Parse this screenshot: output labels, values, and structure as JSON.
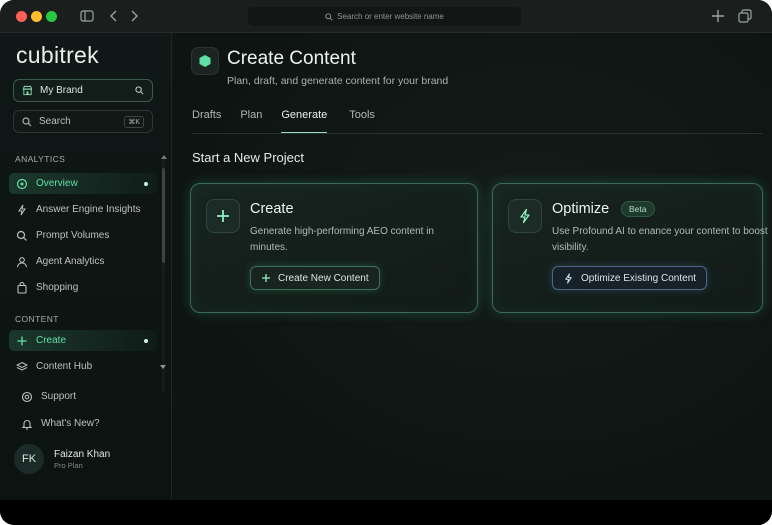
{
  "browser": {
    "url_placeholder": "Search or enter website name"
  },
  "sidebar": {
    "logo": "cubitrek",
    "brand_selector": "My Brand",
    "search_label": "Search",
    "search_shortcut": "⌘K",
    "analytics_label": "ANALYTICS",
    "analytics_items": [
      {
        "label": "Overview",
        "icon": "overview-icon",
        "active": true
      },
      {
        "label": "Answer Engine Insights",
        "icon": "spark-icon"
      },
      {
        "label": "Prompt Volumes",
        "icon": "search-icon"
      },
      {
        "label": "Agent Analytics",
        "icon": "agent-icon"
      },
      {
        "label": "Shopping",
        "icon": "shopping-bag-icon"
      }
    ],
    "content_label": "CONTENT",
    "content_items": [
      {
        "label": "Create",
        "icon": "plus-icon",
        "active": true
      },
      {
        "label": "Content Hub",
        "icon": "layers-icon"
      }
    ],
    "support": "Support",
    "whats_new": "What's New?",
    "user": {
      "initials": "FK",
      "name": "Faizan Khan",
      "plan": "Pro Plan"
    }
  },
  "main": {
    "title": "Create Content",
    "subtitle": "Plan, draft, and generate content for your brand",
    "tabs": [
      {
        "label": "Drafts"
      },
      {
        "label": "Plan"
      },
      {
        "label": "Generate",
        "active": true
      },
      {
        "label": "Tools"
      }
    ],
    "section_title": "Start a New Project",
    "cards": [
      {
        "title": "Create",
        "description": "Generate high-performing AEO content in minutes.",
        "button": "Create New Content"
      },
      {
        "title": "Optimize",
        "badge": "Beta",
        "description": "Use Profound AI to enance your content to boost visibility.",
        "button": "Optimize Existing Content"
      }
    ]
  },
  "colors": {
    "accent": "#5fe0a4",
    "card_border": "#3b6a56",
    "background": "#0e1412"
  }
}
